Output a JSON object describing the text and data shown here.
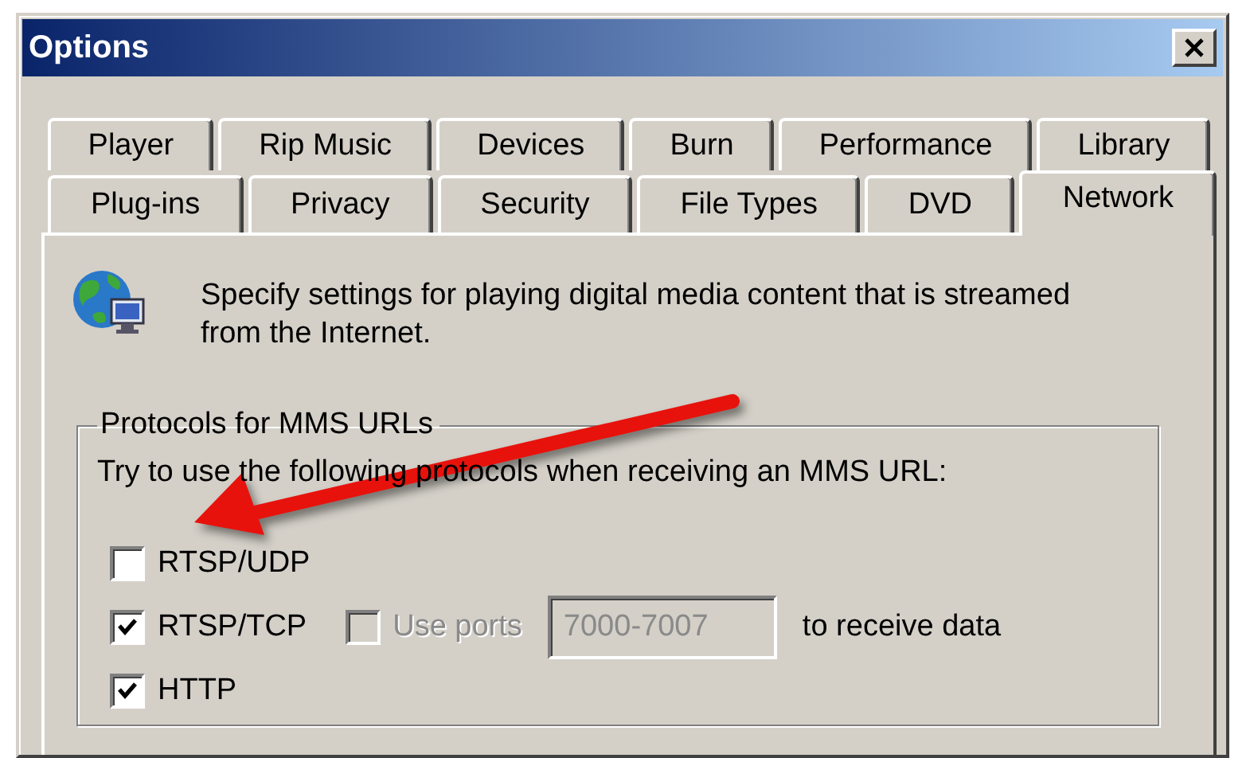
{
  "window": {
    "title": "Options"
  },
  "tab_rows": [
    [
      {
        "label": "Player",
        "selected": false
      },
      {
        "label": "Rip Music",
        "selected": false
      },
      {
        "label": "Devices",
        "selected": false
      },
      {
        "label": "Burn",
        "selected": false
      },
      {
        "label": "Performance",
        "selected": false
      },
      {
        "label": "Library",
        "selected": false
      }
    ],
    [
      {
        "label": "Plug-ins",
        "selected": false
      },
      {
        "label": "Privacy",
        "selected": false
      },
      {
        "label": "Security",
        "selected": false
      },
      {
        "label": "File Types",
        "selected": false
      },
      {
        "label": "DVD",
        "selected": false
      },
      {
        "label": "Network",
        "selected": true
      }
    ]
  ],
  "description": "Specify settings for playing digital media content that is streamed from the Internet.",
  "protocols_group": {
    "legend": "Protocols for MMS URLs",
    "instruction": "Try to use the following protocols when receiving an MMS URL:",
    "protocols": [
      {
        "kind": "plain",
        "label": "RTSP/UDP",
        "checked": false
      },
      {
        "kind": "with_ports",
        "label": "RTSP/TCP",
        "checked": true,
        "ports": {
          "label": "Use ports",
          "checked": false,
          "disabled": true,
          "value": "7000-7007",
          "suffix": "to receive data"
        }
      },
      {
        "kind": "plain",
        "label": "HTTP",
        "checked": true
      }
    ]
  }
}
